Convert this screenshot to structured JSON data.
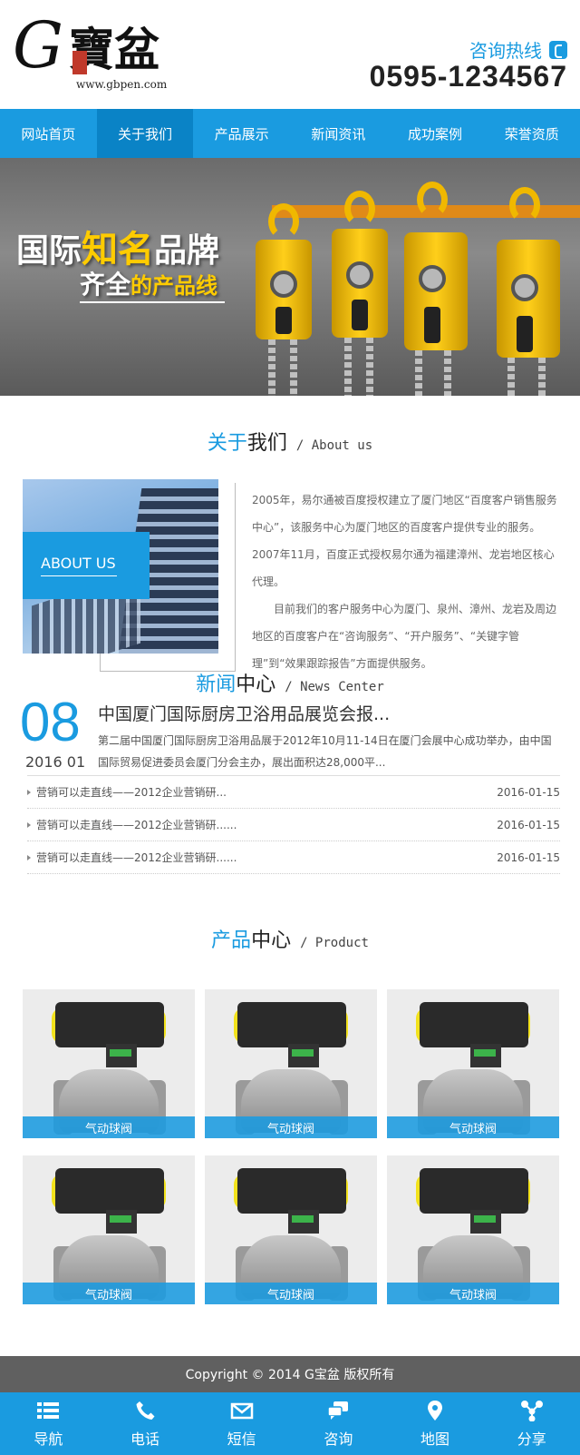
{
  "header": {
    "logo_text": "G寶盆",
    "logo_url": "www.gbpen.com",
    "hotline_label": "咨询热线",
    "phone_number": "0595-1234567"
  },
  "nav": {
    "items": [
      {
        "label": "网站首页"
      },
      {
        "label": "关于我们",
        "active": true
      },
      {
        "label": "产品展示"
      },
      {
        "label": "新闻资讯"
      },
      {
        "label": "成功案例"
      },
      {
        "label": "荣誉资质"
      }
    ]
  },
  "banner": {
    "line1_prefix": "国际",
    "line1_highlight": "知名",
    "line1_suffix": "品牌",
    "line2_prefix": "齐全",
    "line2_highlight": "的产品线"
  },
  "about": {
    "title_highlight": "关于",
    "title_rest": "我们",
    "title_en": "/ About us",
    "box_label": "ABOUT US",
    "paragraph1": "2005年，易尔通被百度授权建立了厦门地区“百度客户销售服务中心”，该服务中心为厦门地区的百度客户提供专业的服务。2007年11月，百度正式授权易尔通为福建漳州、龙岩地区核心代理。",
    "paragraph2": "目前我们的客户服务中心为厦门、泉州、漳州、龙岩及周边地区的百度客户在“咨询服务”、“开户服务”、“关键字管理”到“效果跟踪报告”方面提供服务。"
  },
  "news": {
    "title_highlight": "新闻",
    "title_rest": "中心",
    "title_en": "/ News Center",
    "featured": {
      "day": "08",
      "year_month": "2016 01",
      "headline": "中国厦门国际厨房卫浴用品展览会报...",
      "summary": "第二届中国厦门国际厨房卫浴用品展于2012年10月11-14日在厦门会展中心成功举办，由中国国际贸易促进委员会厦门分会主办，展出面积达28,000平..."
    },
    "items": [
      {
        "title": "营销可以走直线——2012企业营销研...",
        "date": "2016-01-15"
      },
      {
        "title": "营销可以走直线——2012企业营销研......",
        "date": "2016-01-15"
      },
      {
        "title": "营销可以走直线——2012企业营销研......",
        "date": "2016-01-15"
      }
    ]
  },
  "products": {
    "title_highlight": "产品",
    "title_rest": "中心",
    "title_en": "/ Product",
    "items": [
      {
        "name": "气动球阀"
      },
      {
        "name": "气动球阀"
      },
      {
        "name": "气动球阀"
      },
      {
        "name": "气动球阀"
      },
      {
        "name": "气动球阀"
      },
      {
        "name": "气动球阀"
      }
    ]
  },
  "footer": {
    "copyright": "Copyright © 2014 G宝盆 版权所有"
  },
  "bottom_bar": {
    "items": [
      {
        "label": "导航",
        "icon": "menu-icon"
      },
      {
        "label": "电话",
        "icon": "phone-icon"
      },
      {
        "label": "短信",
        "icon": "mail-icon"
      },
      {
        "label": "咨询",
        "icon": "chat-icon"
      },
      {
        "label": "地图",
        "icon": "map-pin-icon"
      },
      {
        "label": "分享",
        "icon": "share-icon"
      }
    ]
  },
  "colors": {
    "accent": "#1a9be0",
    "nav_active": "#0a83c6",
    "footer_bg": "#606060"
  }
}
